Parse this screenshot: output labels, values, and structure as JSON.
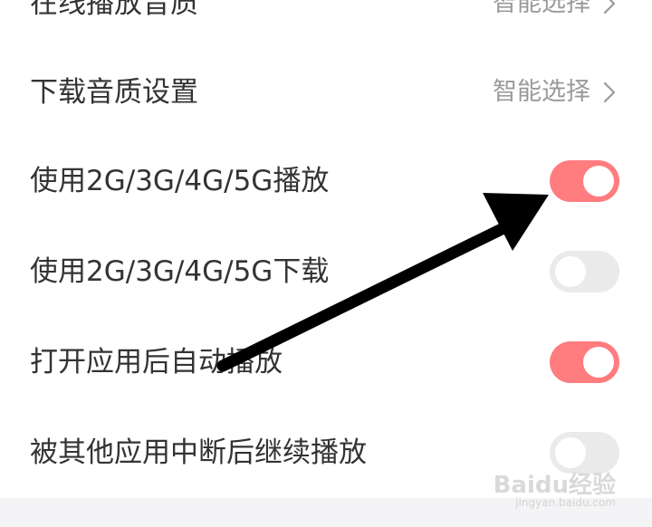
{
  "settings": {
    "rows": [
      {
        "label": "在线播放音质",
        "value": "智能选择"
      },
      {
        "label": "下载音质设置",
        "value": "智能选择"
      },
      {
        "label": "使用2G/3G/4G/5G播放",
        "toggle_on": true
      },
      {
        "label": "使用2G/3G/4G/5G下载",
        "toggle_on": false
      },
      {
        "label": "打开应用后自动播放",
        "toggle_on": true
      },
      {
        "label": "被其他应用中断后继续播放",
        "toggle_on": false
      }
    ]
  },
  "annotation": {
    "arrow_color": "#000000",
    "points_to": "使用2G/3G/4G/5G播放"
  },
  "colors": {
    "toggle_on": "#ff7c7f",
    "toggle_off": "#eaeaea",
    "label": "#333333",
    "value": "#9a9a9a"
  },
  "watermark": {
    "logo": "Baidu经验",
    "url": "jingyan.baidu.com"
  }
}
